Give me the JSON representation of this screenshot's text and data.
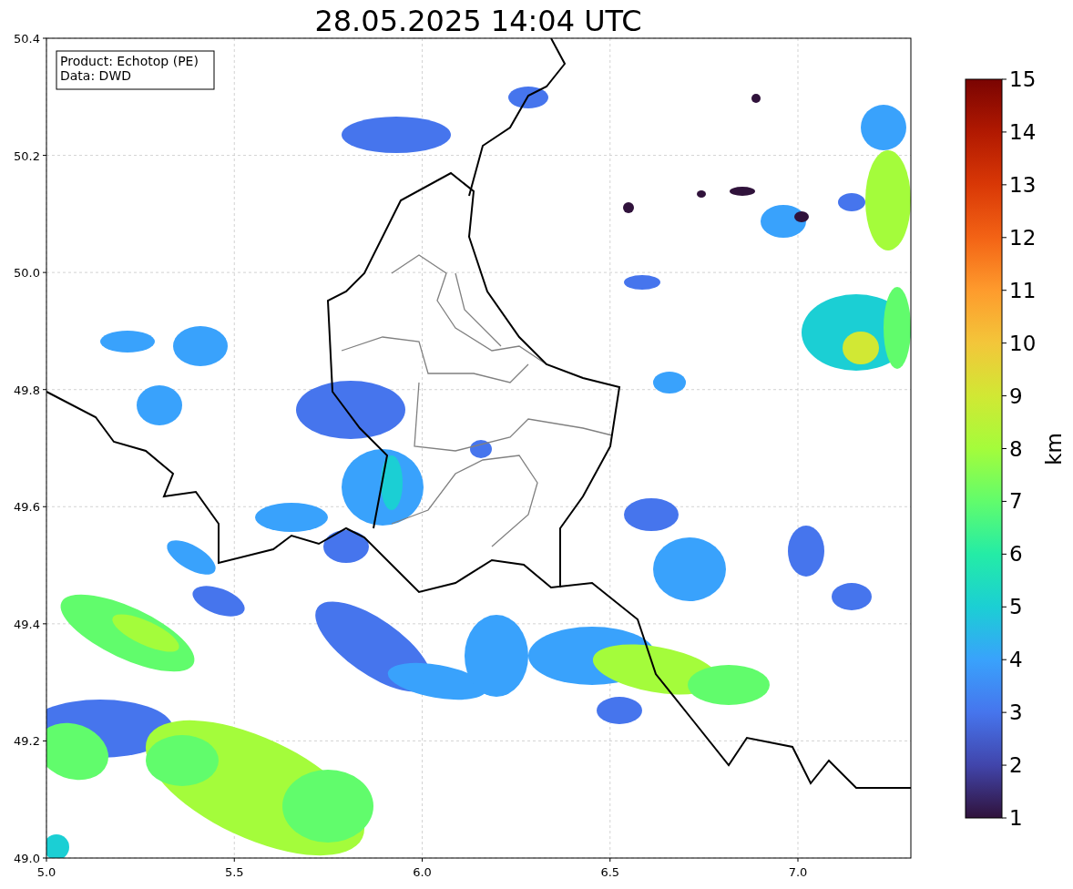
{
  "title": "28.05.2025 14:04 UTC",
  "legend": {
    "lines": [
      "Product: Echotop (PE)",
      "Data: DWD"
    ]
  },
  "x_axis": {
    "ticks": [
      "5.0",
      "5.5",
      "6.0",
      "6.5",
      "7.0"
    ]
  },
  "y_axis": {
    "ticks": [
      "50.4",
      "50.2",
      "50.0",
      "49.8",
      "49.6",
      "49.4",
      "49.2",
      "49.0"
    ]
  },
  "colorbar": {
    "label": "km",
    "ticks": [
      "15",
      "14",
      "13",
      "12",
      "11",
      "10",
      "9",
      "8",
      "7",
      "6",
      "5",
      "4",
      "3",
      "2",
      "1"
    ]
  }
}
